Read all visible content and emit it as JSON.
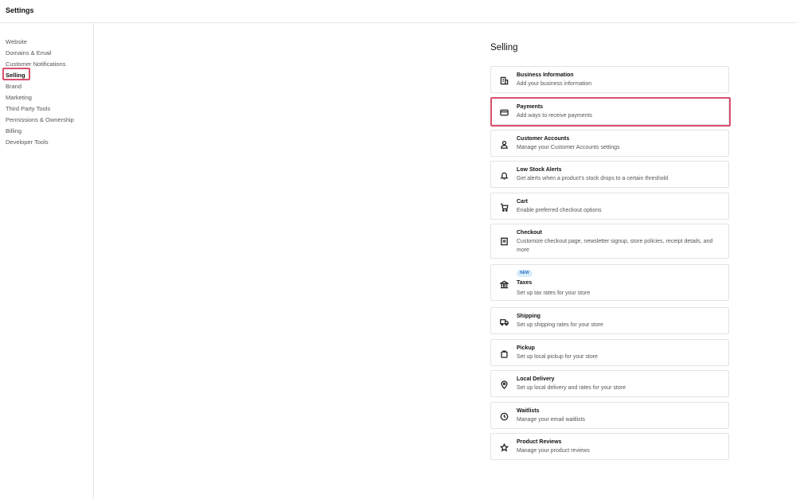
{
  "header": {
    "title": "Settings"
  },
  "sidebar": {
    "items": [
      {
        "label": "Website"
      },
      {
        "label": "Domains & Email"
      },
      {
        "label": "Customer Notifications"
      },
      {
        "label": "Selling"
      },
      {
        "label": "Brand"
      },
      {
        "label": "Marketing"
      },
      {
        "label": "Third Party Tools"
      },
      {
        "label": "Permissions & Ownership"
      },
      {
        "label": "Billing"
      },
      {
        "label": "Developer Tools"
      }
    ],
    "active": "Selling"
  },
  "main": {
    "title": "Selling",
    "cards": [
      {
        "icon": "building-icon",
        "label": "Business Information",
        "desc": "Add your business information"
      },
      {
        "icon": "credit-card-icon",
        "label": "Payments",
        "desc": "Add ways to receive payments"
      },
      {
        "icon": "person-icon",
        "label": "Customer Accounts",
        "desc": "Manage your Customer Accounts settings"
      },
      {
        "icon": "bell-icon",
        "label": "Low Stock Alerts",
        "desc": "Get alerts when a product’s stock drops to a certain threshold"
      },
      {
        "icon": "cart-icon",
        "label": "Cart",
        "desc": "Enable preferred checkout options"
      },
      {
        "icon": "receipt-icon",
        "label": "Checkout",
        "desc": "Customize checkout page, newsletter signup, store policies, receipt details, and more"
      },
      {
        "icon": "bank-icon",
        "label": "Taxes",
        "desc": "Set up tax rates for your store",
        "badge": "NEW"
      },
      {
        "icon": "truck-icon",
        "label": "Shipping",
        "desc": "Set up shipping rates for your store"
      },
      {
        "icon": "bag-icon",
        "label": "Pickup",
        "desc": "Set up local pickup for your store"
      },
      {
        "icon": "location-pin-icon",
        "label": "Local Delivery",
        "desc": "Set up local delivery and rates for your store"
      },
      {
        "icon": "clock-icon",
        "label": "Waitlists",
        "desc": "Manage your email waitlists"
      },
      {
        "icon": "star-icon",
        "label": "Product Reviews",
        "desc": "Manage your product reviews"
      }
    ]
  },
  "colors": {
    "highlight": "#d9506b",
    "badge_bg": "#d8ecfb",
    "badge_text": "#2a72c0"
  }
}
